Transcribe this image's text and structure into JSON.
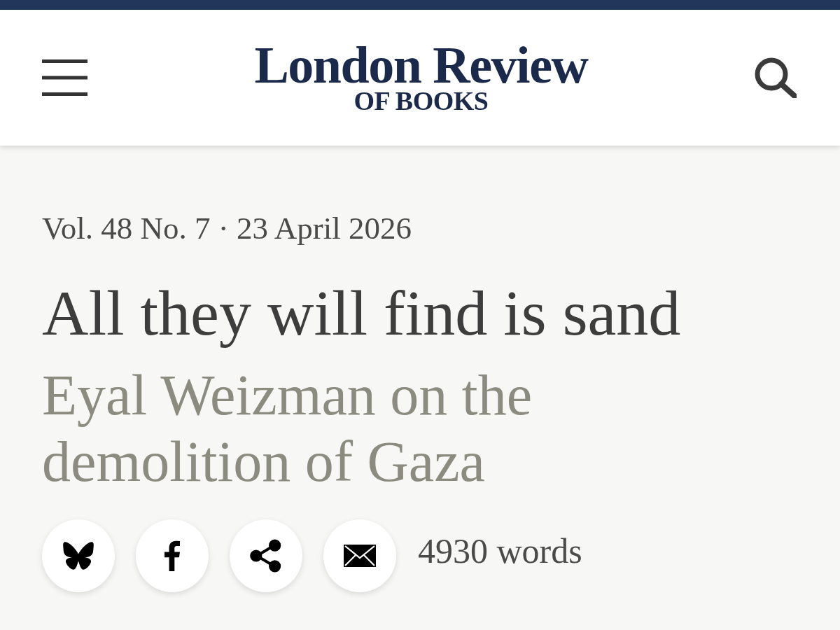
{
  "header": {
    "logo": {
      "title": "London Review",
      "subtitle": "OF BOOKS"
    }
  },
  "article": {
    "issue": "Vol. 48 No. 7 · 23 April 2026",
    "title": "All they will find is sand",
    "standfirst": "Eyal Weizman on the demolition of Gaza",
    "share_buttons": [
      {
        "kind": "butterfly"
      },
      {
        "kind": "facebook"
      },
      {
        "kind": "share"
      },
      {
        "kind": "email"
      }
    ],
    "word_count": "4930 words"
  }
}
